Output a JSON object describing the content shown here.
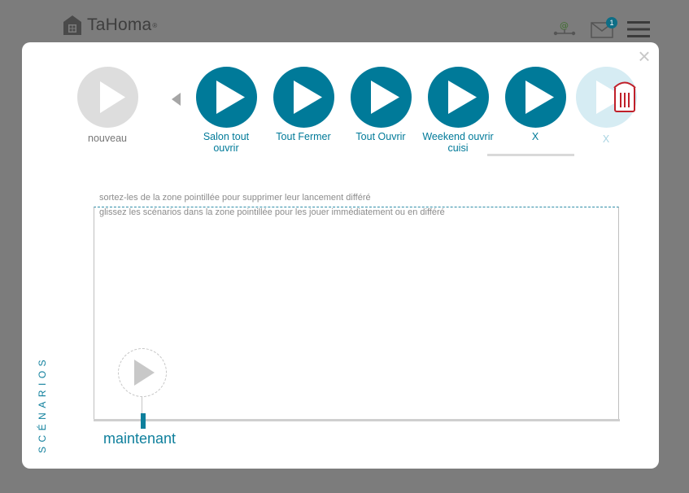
{
  "header": {
    "brand": "TaHoma",
    "brand_mark": "®",
    "mail_count": "1",
    "icons": [
      "house-logo-icon",
      "at-network-icon",
      "mail-icon",
      "menu-icon"
    ]
  },
  "modal": {
    "close_label": "×",
    "new_scenario_label": "nouveau",
    "scenarios": [
      {
        "label": "Salon tout ouvrir"
      },
      {
        "label": "Tout Fermer"
      },
      {
        "label": "Tout Ouvrir"
      },
      {
        "label": "Weekend ouvrir cuisi"
      },
      {
        "label": "X"
      }
    ],
    "dragged_scenario_label": "X",
    "hint_remove": "sortez-les de la zone pointillée pour supprimer leur lancement différé",
    "hint_drop": "glissez les scénarios dans la zone pointillée pour les jouer immédiatement ou en différé",
    "now_label": "maintenant",
    "side_title": "SCÉNARIOS"
  },
  "colors": {
    "accent": "#007a99",
    "trash": "#c0202a",
    "backdrop": "#7c7c7c"
  }
}
